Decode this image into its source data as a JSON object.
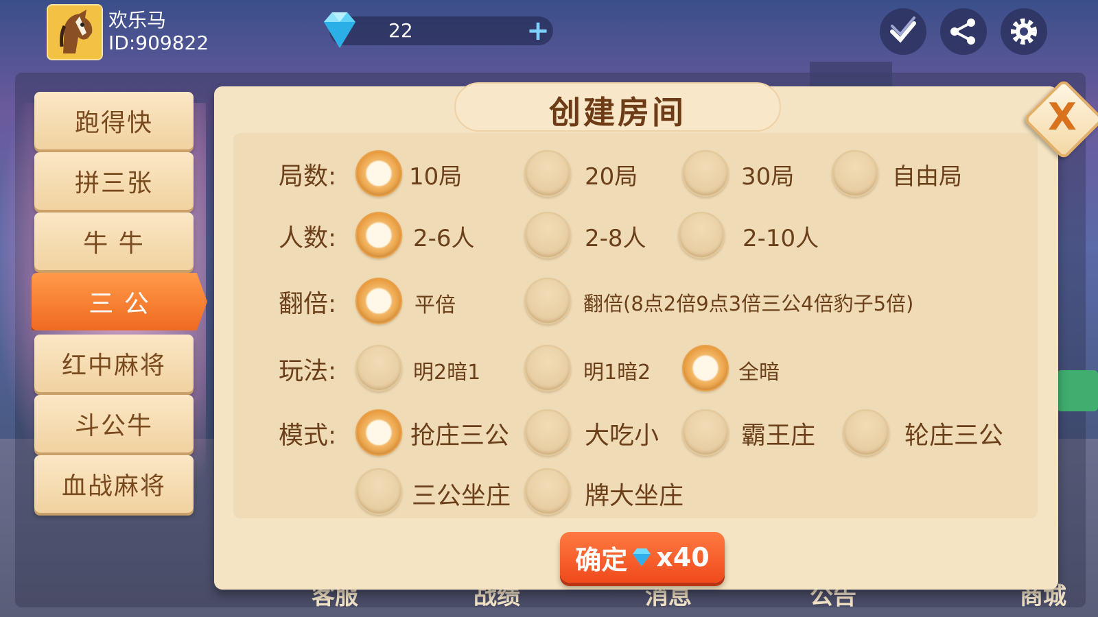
{
  "user": {
    "name": "欢乐马",
    "id": "ID:909822"
  },
  "diamond": {
    "count": "22",
    "plus": "+"
  },
  "tabs": [
    {
      "label": "跑得快"
    },
    {
      "label": "拼三张"
    },
    {
      "label": "牛 牛"
    },
    {
      "label": "三 公",
      "active": true
    },
    {
      "label": "红中麻将"
    },
    {
      "label": "斗公牛"
    },
    {
      "label": "血战麻将"
    }
  ],
  "dialog": {
    "title": "创建房间",
    "close": "X",
    "rows": {
      "rounds": {
        "label": "局数:",
        "options": [
          "10局",
          "20局",
          "30局",
          "自由局"
        ],
        "selected": 0
      },
      "players": {
        "label": "人数:",
        "options": [
          "2-6人",
          "2-8人",
          "2-10人"
        ],
        "selected": 0
      },
      "multiplier": {
        "label": "翻倍:",
        "options": [
          "平倍",
          "翻倍(8点2倍9点3倍三公4倍豹子5倍)"
        ],
        "selected": 0
      },
      "playstyle": {
        "label": "玩法:",
        "options": [
          "明2暗1",
          "明1暗2",
          "全暗"
        ],
        "selected": 2
      },
      "mode": {
        "label": "模式:",
        "options": [
          "抢庄三公",
          "大吃小",
          "霸王庄",
          "轮庄三公",
          "三公坐庄",
          "牌大坐庄"
        ],
        "selected": 0
      }
    },
    "confirm": {
      "label": "确定",
      "cost": "x40"
    }
  },
  "bottom_nav": [
    "客服",
    "战绩",
    "消息",
    "公告",
    "商城"
  ],
  "colors": {
    "accent": "#f06a20",
    "panel": "#f5e4c3",
    "text_brown": "#6b3f1a"
  }
}
